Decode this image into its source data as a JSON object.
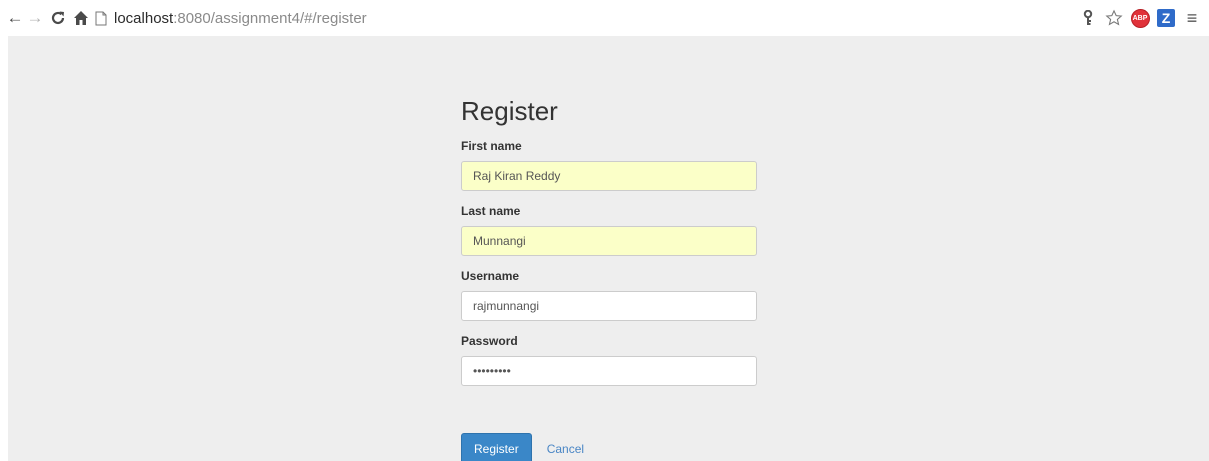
{
  "browser": {
    "url_host": "localhost",
    "url_rest": ":8080/assignment4/#/register",
    "icons": [
      "back-arrow-icon",
      "forward-arrow-icon",
      "reload-icon",
      "home-icon",
      "page-icon",
      "key-icon",
      "star-icon",
      "adblock-icon",
      "zotero-icon",
      "menu-icon"
    ],
    "abp_text": "ABP",
    "z_text": "Z"
  },
  "form": {
    "title": "Register",
    "fields": [
      {
        "label": "First name",
        "value": "Raj Kiran Reddy",
        "autofilled": true
      },
      {
        "label": "Last name",
        "value": "Munnangi",
        "autofilled": true
      },
      {
        "label": "Username",
        "value": "rajmunnangi",
        "autofilled": false
      },
      {
        "label": "Password",
        "value": "•••••••••",
        "autofilled": false
      }
    ],
    "submit_label": "Register",
    "cancel_label": "Cancel"
  },
  "colors": {
    "page_bg": "#eeeeee",
    "autofill_bg": "#fbffc8",
    "primary_button": "#3a87c8",
    "link": "#4a86c5"
  }
}
